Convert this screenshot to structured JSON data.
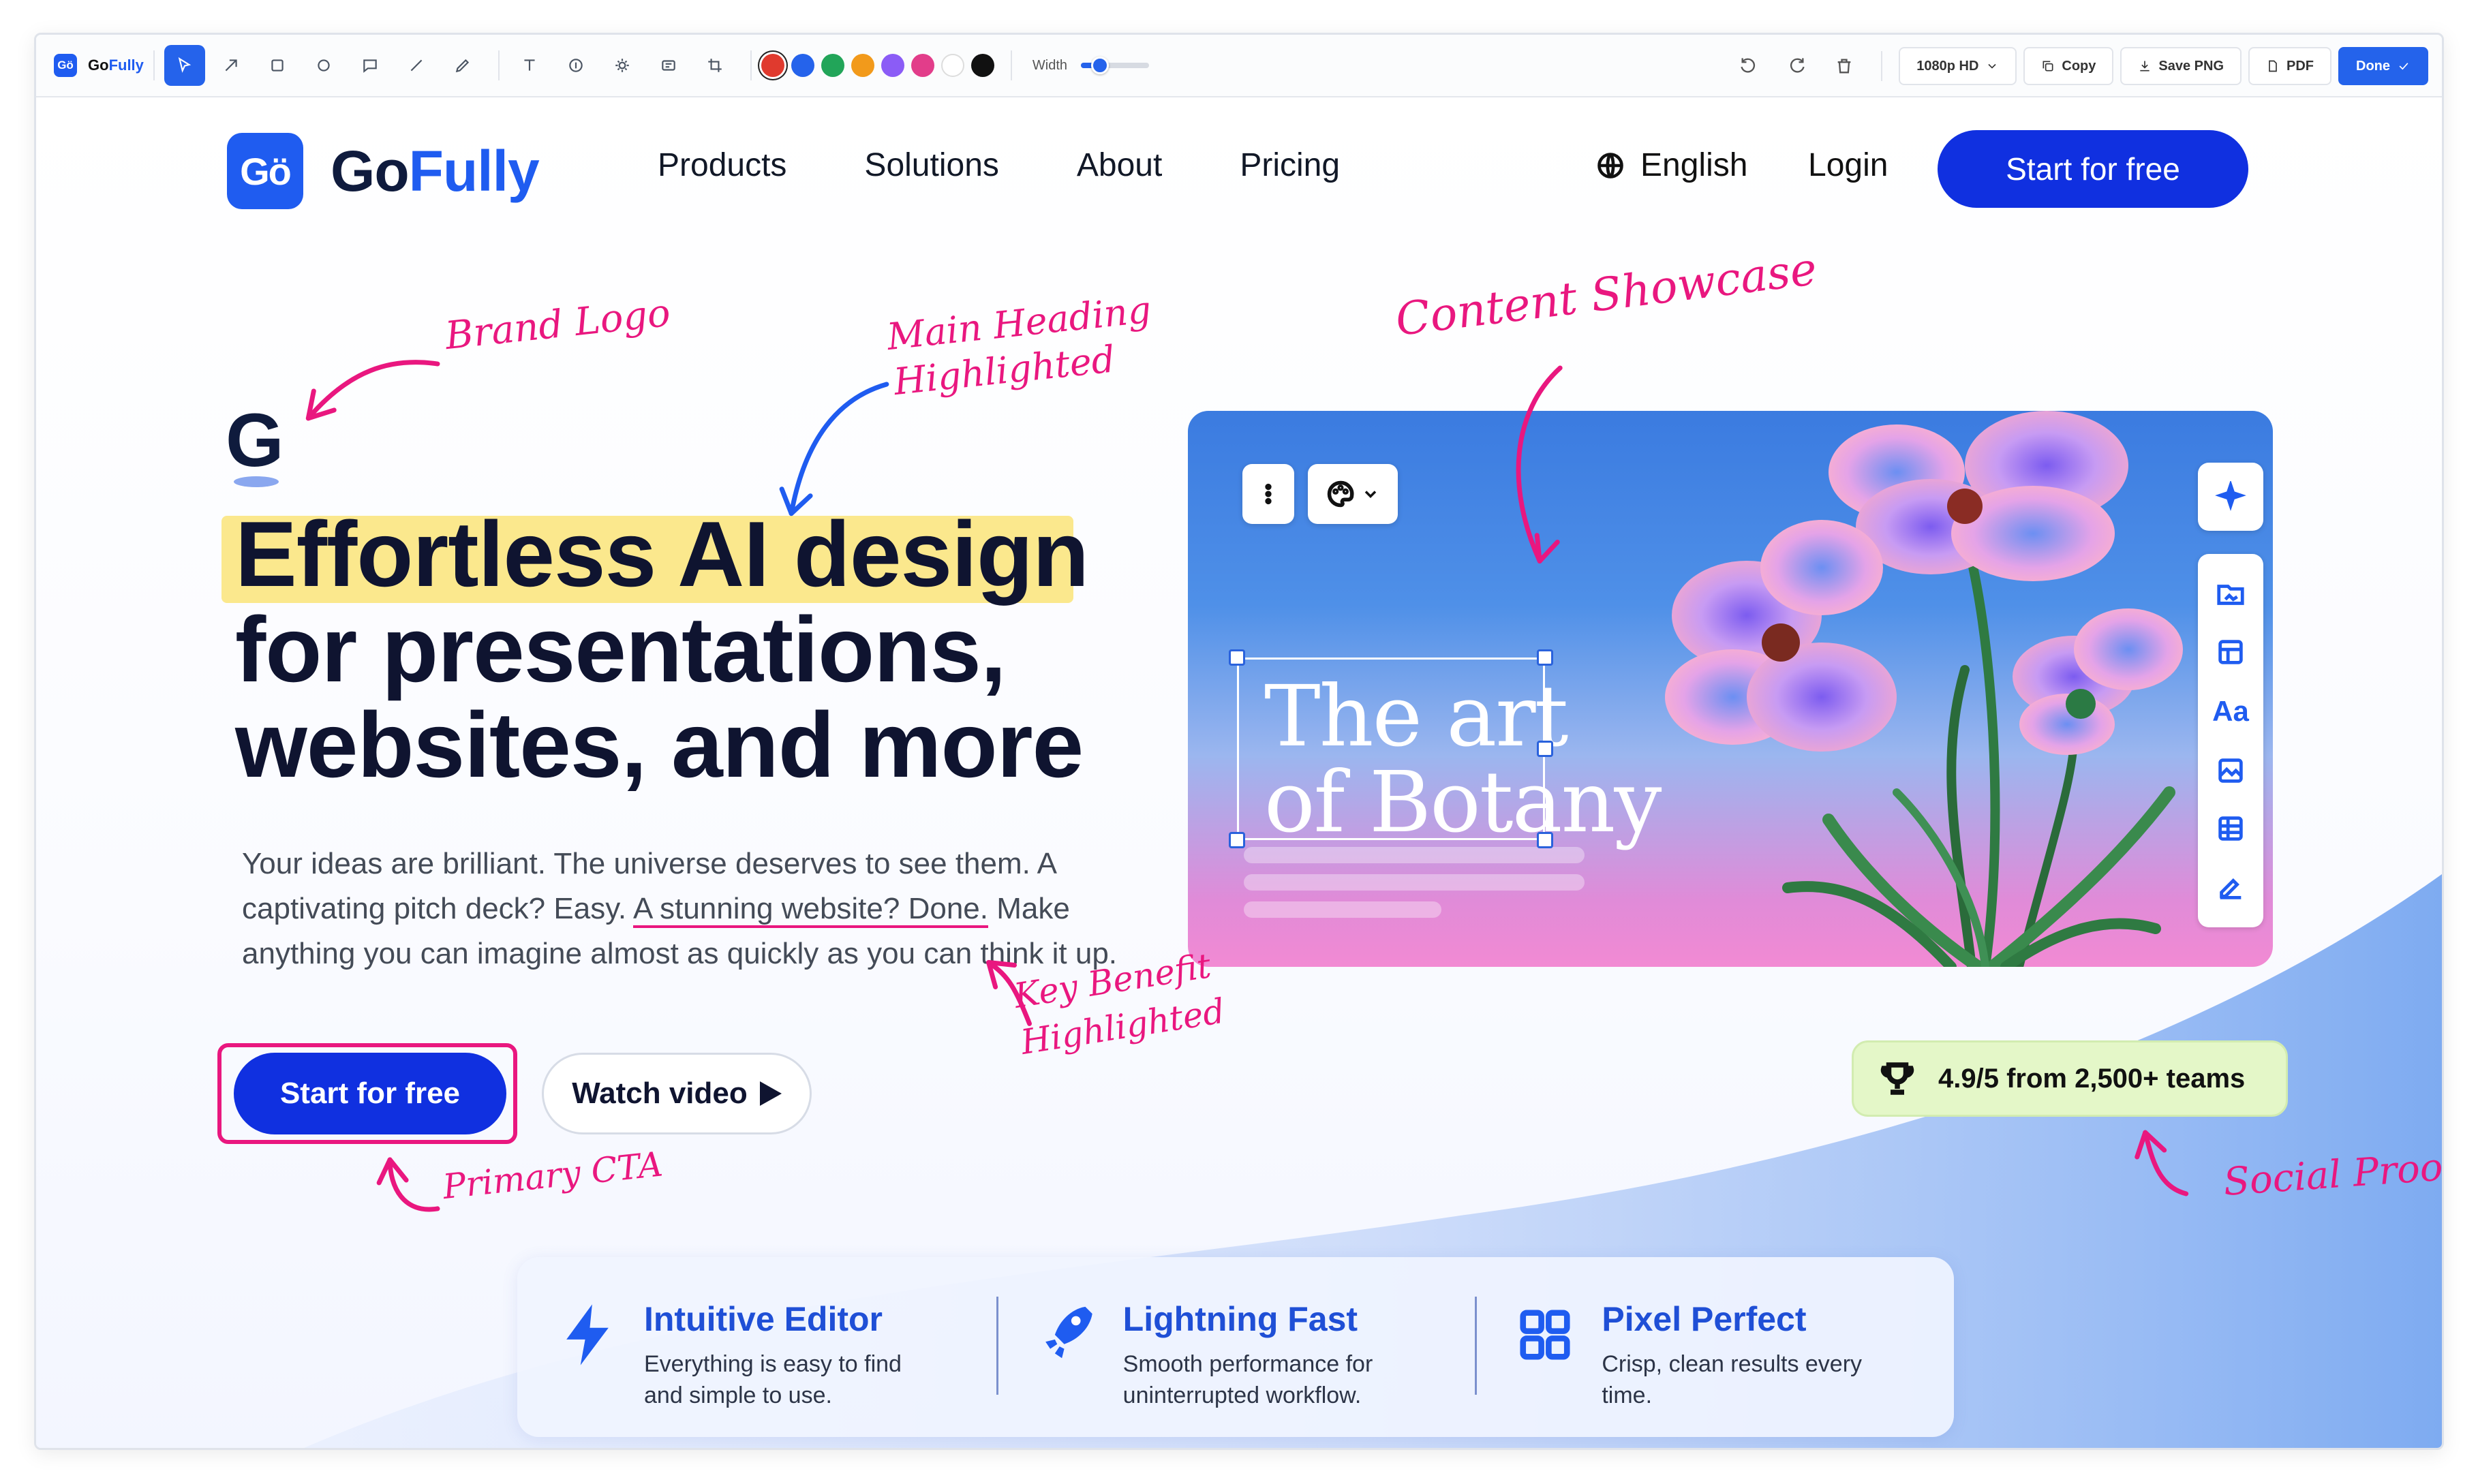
{
  "editor": {
    "app_name_prefix": "Go",
    "app_name_suffix": "Fully",
    "logo_glyph": "Gö",
    "tools": [
      "select-icon",
      "arrow-icon",
      "rectangle-icon",
      "circle-icon",
      "comment-icon",
      "line-icon",
      "pen-icon",
      "text-icon",
      "number-marker-icon",
      "blur-icon",
      "highlight-icon",
      "crop-icon"
    ],
    "colors": [
      "#e03a2e",
      "#2563eb",
      "#22a559",
      "#f29a1b",
      "#8b5cf6",
      "#e23d8a",
      "#ffffff",
      "#111111"
    ],
    "width_label": "Width",
    "width_level": 0.28,
    "resolution": "1080p HD",
    "copy_label": "Copy",
    "save_label": "Save PNG",
    "pdf_label": "PDF",
    "done_label": "Done"
  },
  "site": {
    "logo_glyph": "Gö",
    "brand_prefix": "Go",
    "brand_suffix": "Fully",
    "nav": [
      "Products",
      "Solutions",
      "About",
      "Pricing"
    ],
    "language": "English",
    "login": "Login",
    "nav_cta": "Start for free"
  },
  "hero": {
    "mark": "G",
    "heading_line1": "Effortless AI design",
    "heading_line2": "for presentations,",
    "heading_line3": "websites, and more",
    "sub_part1": "Your ideas are brilliant. The universe deserves to see them. A captivating pitch deck? Easy. ",
    "sub_highlight": "A stunning website? Done.",
    "sub_part2": " Make anything you can imagine almost as quickly as you can think it up.",
    "cta": "Start for free",
    "watch": "Watch video"
  },
  "showcase": {
    "title_line1": "The art",
    "title_line2": "of Botany"
  },
  "proof": {
    "text": "4.9/5 from 2,500+ teams"
  },
  "features": [
    {
      "title": "Intuitive Editor",
      "desc": "Everything is easy to find and simple to use."
    },
    {
      "title": "Lightning Fast",
      "desc": "Smooth performance for uninterrupted workflow."
    },
    {
      "title": "Pixel Perfect",
      "desc": "Crisp, clean results every time."
    }
  ],
  "annotations": {
    "brand_logo": "Brand Logo",
    "main_heading_1": "Main Heading",
    "main_heading_2": "Highlighted",
    "content_showcase": "Content Showcase",
    "key_benefit_1": "Key Benefit",
    "key_benefit_2": "Highlighted",
    "primary_cta": "Primary CTA",
    "social_proof": "Social Proof",
    "accent_color": "#e9177f",
    "blue_arrow_color": "#1f5cf0"
  }
}
